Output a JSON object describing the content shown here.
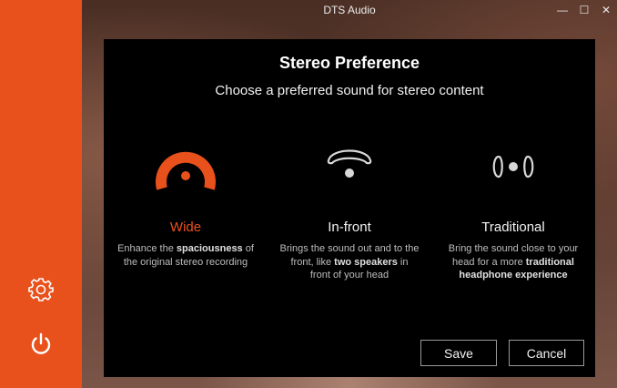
{
  "window": {
    "title": "DTS Audio",
    "controls": {
      "minimize": "—",
      "maximize": "☐",
      "close": "✕"
    }
  },
  "sidebar": {
    "items": [
      {
        "name": "settings",
        "icon": "gear-icon"
      },
      {
        "name": "power",
        "icon": "power-icon"
      }
    ],
    "color": "#e8511c"
  },
  "dialog": {
    "title": "Stereo Preference",
    "subtitle": "Choose a preferred sound for stereo content",
    "options": [
      {
        "label": "Wide",
        "icon": "wide-sound-icon",
        "selected": true,
        "desc": [
          {
            "text": "Enhance the ",
            "bold": false
          },
          {
            "text": "spaciousness",
            "bold": true
          },
          {
            "text": " of the original stereo recording",
            "bold": false
          }
        ]
      },
      {
        "label": "In-front",
        "icon": "in-front-sound-icon",
        "selected": false,
        "desc": [
          {
            "text": "Brings the sound out and to the front, like ",
            "bold": false
          },
          {
            "text": "two speakers",
            "bold": true
          },
          {
            "text": " in front of your head",
            "bold": false
          }
        ]
      },
      {
        "label": "Traditional",
        "icon": "traditional-sound-icon",
        "selected": false,
        "desc": [
          {
            "text": "Bring the sound close to your head for a more ",
            "bold": false
          },
          {
            "text": "traditional headphone experience",
            "bold": true
          }
        ]
      }
    ],
    "buttons": {
      "save": "Save",
      "cancel": "Cancel"
    }
  },
  "colors": {
    "accent": "#e8511c",
    "dialog_bg": "#000000",
    "icon_gray": "#d8d8d8"
  }
}
